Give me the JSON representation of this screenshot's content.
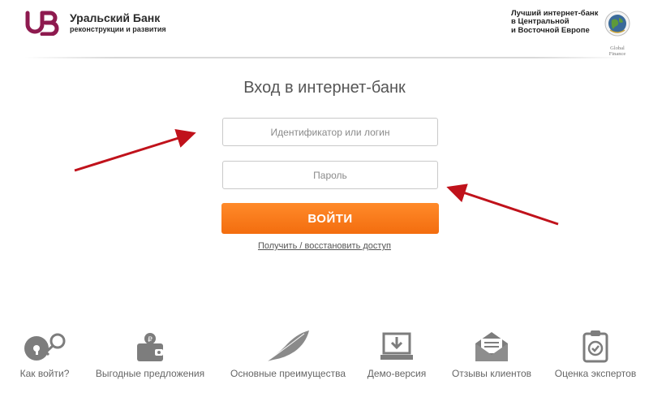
{
  "header": {
    "logo_name": "Уральский Банк",
    "logo_sub": "реконструкции и развития",
    "award_lines": [
      "Лучший интернет-банк",
      "в Центральной",
      "и Восточной Европе"
    ],
    "award_badge_text": "Global Finance"
  },
  "login": {
    "title": "Вход в интернет-банк",
    "login_placeholder": "Идентификатор или логин",
    "password_placeholder": "Пароль",
    "button_label": "ВОЙТИ",
    "restore_link": "Получить / восстановить доступ"
  },
  "features": [
    {
      "label": "Как войти?",
      "icon": "key-icon"
    },
    {
      "label": "Выгодные предложения",
      "icon": "wallet-icon"
    },
    {
      "label": "Основные преимущества",
      "icon": "feather-icon"
    },
    {
      "label": "Демо-версия",
      "icon": "laptop-download-icon"
    },
    {
      "label": "Отзывы клиентов",
      "icon": "envelope-icon"
    },
    {
      "label": "Оценка экспертов",
      "icon": "clipboard-check-icon"
    }
  ],
  "colors": {
    "brand": "#8e1a4f",
    "button": "#f36d0e",
    "arrow": "#c0121b",
    "icon": "#7d7d7d"
  }
}
